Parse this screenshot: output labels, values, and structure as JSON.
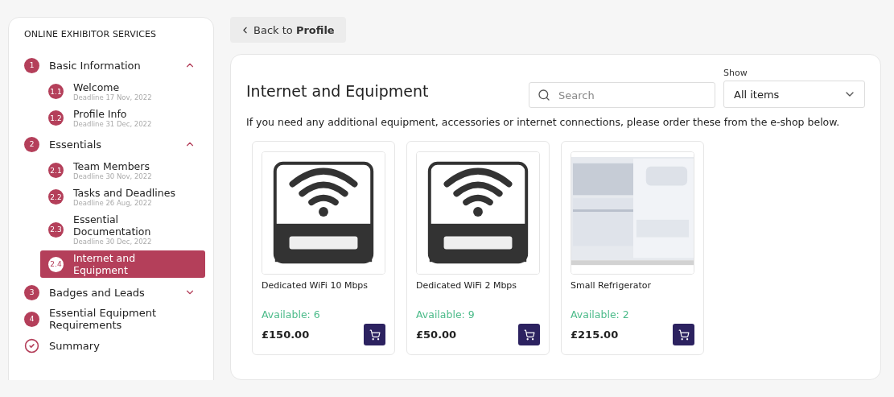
{
  "sidebar": {
    "title": "ONLINE EXHIBITOR SERVICES",
    "sections": [
      {
        "kind": "step",
        "number": "1",
        "label": "Basic Information",
        "expanded": true,
        "children": [
          {
            "number": "1.1",
            "label": "Welcome",
            "deadline": "Deadline 17 Nov, 2022",
            "selected": false
          },
          {
            "number": "1.2",
            "label": "Profile Info",
            "deadline": "Deadline 31 Dec, 2022",
            "selected": false
          }
        ]
      },
      {
        "kind": "step",
        "number": "2",
        "label": "Essentials",
        "expanded": true,
        "children": [
          {
            "number": "2.1",
            "label": "Team Members",
            "deadline": "Deadline 30 Nov, 2022",
            "selected": false
          },
          {
            "number": "2.2",
            "label": "Tasks and Deadlines",
            "deadline": "Deadline 26 Aug, 2022",
            "selected": false
          },
          {
            "number": "2.3",
            "label": "Essential Documentation",
            "deadline": "Deadline 30 Dec, 2022",
            "selected": false
          },
          {
            "number": "2.4",
            "label": "Internet and Equipment",
            "selected": true
          }
        ]
      },
      {
        "kind": "step",
        "number": "3",
        "label": "Badges and Leads",
        "expanded": false
      },
      {
        "kind": "step",
        "number": "4",
        "label": "Essential Equipment Requirements"
      },
      {
        "kind": "summary",
        "label": "Summary"
      }
    ]
  },
  "back_button": {
    "prefix": "Back to",
    "label": "Profile"
  },
  "content": {
    "title": "Internet and Equipment",
    "search": {
      "placeholder": "Search"
    },
    "show": {
      "label": "Show",
      "value": "All items"
    },
    "description": "If you need any additional equipment, accessories or internet connections, please order these from the e-shop below.",
    "products": [
      {
        "kind": "wifi",
        "name": "Dedicated WiFi 10 Mbps",
        "availability": "Available: 6",
        "price": "£150.00"
      },
      {
        "kind": "wifi",
        "name": "Dedicated WiFi 2 Mbps",
        "availability": "Available: 9",
        "price": "£50.00"
      },
      {
        "kind": "fridge",
        "name": "Small Refrigerator",
        "availability": "Available: 2",
        "price": "£215.00"
      }
    ]
  }
}
